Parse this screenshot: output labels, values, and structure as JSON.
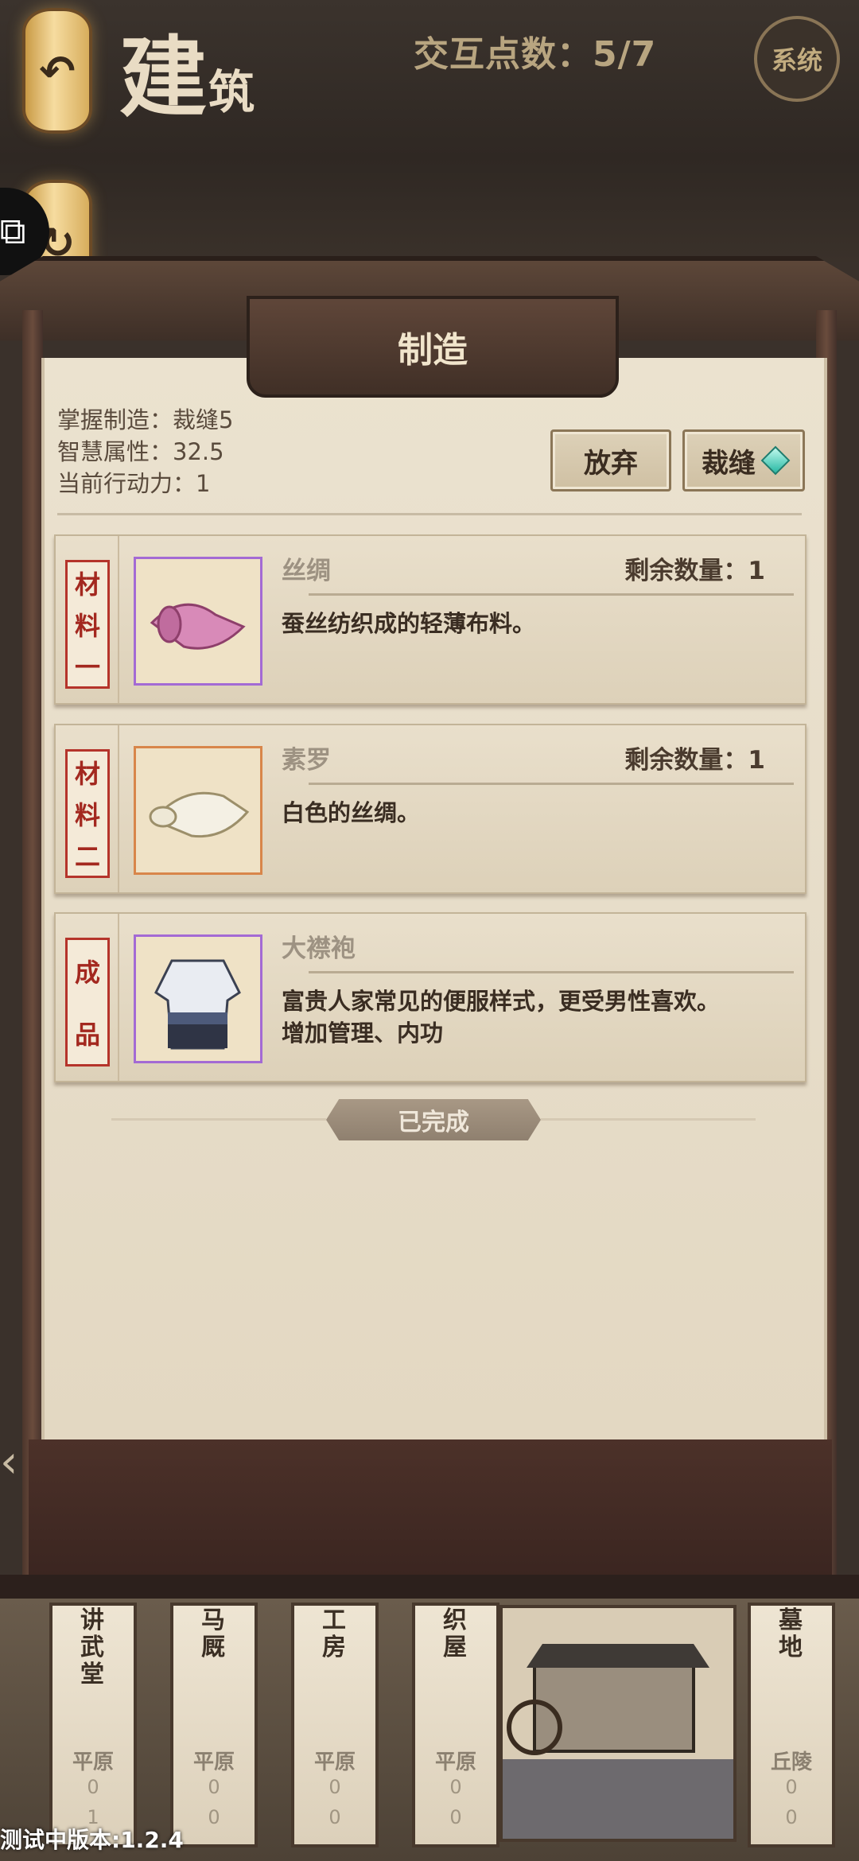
{
  "header": {
    "title_main": "建",
    "title_small": "筑",
    "points_label": "交互点数：5/7",
    "system_label": "系统"
  },
  "panel": {
    "title": "制造",
    "stats": [
      "掌握制造：裁缝5",
      "智慧属性：32.5",
      "当前行动力：1"
    ],
    "abandon_label": "放弃",
    "craft_label": "裁缝"
  },
  "cards": [
    {
      "tag": [
        "材",
        "料",
        "一"
      ],
      "name": "丝绸",
      "remain": "剩余数量：1",
      "desc": "蚕丝纺织成的轻薄布料。",
      "frame_color": "#a36ad4",
      "icon": "silk-cloth-icon"
    },
    {
      "tag": [
        "材",
        "料",
        "二"
      ],
      "name": "素罗",
      "remain": "剩余数量：1",
      "desc": "白色的丝绸。",
      "frame_color": "#d8864a",
      "icon": "white-silk-scroll-icon"
    },
    {
      "tag": [
        "成",
        "品"
      ],
      "name": "大襟袍",
      "remain": "",
      "desc": "富贵人家常见的便服样式，更受男性喜欢。\n增加管理、内功",
      "frame_color": "#a36ad4",
      "icon": "robe-icon"
    }
  ],
  "status": "已完成",
  "buildings": [
    {
      "name": "讲武堂",
      "terrain": "平原",
      "c1": "0",
      "c2": "1"
    },
    {
      "name": "马厩",
      "terrain": "平原",
      "c1": "0",
      "c2": "0"
    },
    {
      "name": "工房",
      "terrain": "平原",
      "c1": "0",
      "c2": "0"
    },
    {
      "name": "织屋",
      "terrain": "平原",
      "c1": "0",
      "c2": "0"
    },
    {
      "name": "墓地",
      "terrain": "丘陵",
      "c1": "0",
      "c2": "0"
    }
  ],
  "version": "测试中版本:1.2.4"
}
